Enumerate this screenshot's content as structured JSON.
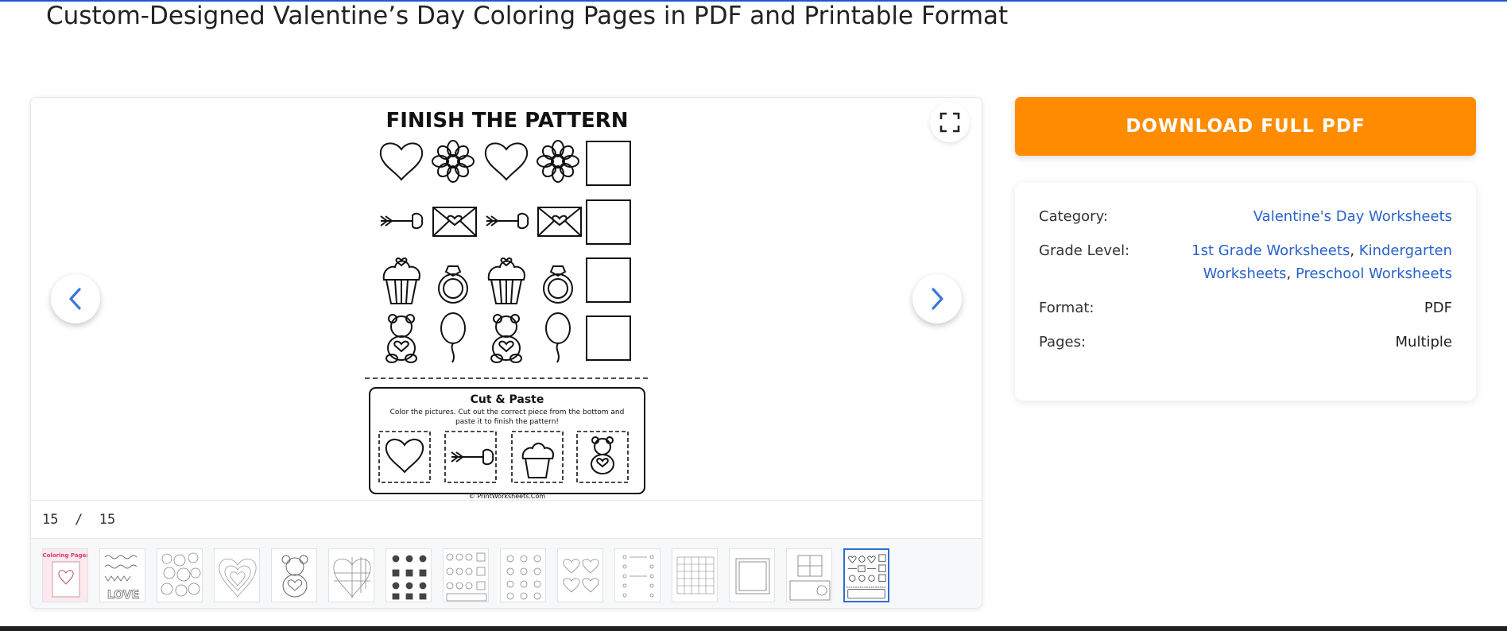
{
  "page": {
    "title": "Custom-Designed Valentine’s Day Coloring Pages in PDF and Printable Format"
  },
  "viewer": {
    "current_page": "15",
    "separator": "/",
    "total_pages": "15",
    "sheet": {
      "title": "FINISH THE PATTERN",
      "cut_title": "Cut & Paste",
      "instructions_line1": "Color the pictures. Cut out the correct piece from the bottom and",
      "instructions_line2": "paste it to finish the pattern!",
      "footer": "© PrintWorksheets.Com"
    },
    "thumbnails": [
      {
        "name": "thumb-1",
        "caption": "Coloring Pages"
      },
      {
        "name": "thumb-2",
        "caption": "LOVE"
      },
      {
        "name": "thumb-3",
        "caption": ""
      },
      {
        "name": "thumb-4",
        "caption": ""
      },
      {
        "name": "thumb-5",
        "caption": ""
      },
      {
        "name": "thumb-6",
        "caption": ""
      },
      {
        "name": "thumb-7",
        "caption": ""
      },
      {
        "name": "thumb-8",
        "caption": ""
      },
      {
        "name": "thumb-9",
        "caption": ""
      },
      {
        "name": "thumb-10",
        "caption": ""
      },
      {
        "name": "thumb-11",
        "caption": ""
      },
      {
        "name": "thumb-12",
        "caption": ""
      },
      {
        "name": "thumb-13",
        "caption": ""
      },
      {
        "name": "thumb-14",
        "caption": ""
      },
      {
        "name": "thumb-15",
        "caption": ""
      }
    ],
    "active_thumbnail": 15
  },
  "sidebar": {
    "download_label": "DOWNLOAD FULL PDF",
    "accent_color": "#ff8c00",
    "link_color": "#2a62c9",
    "meta": {
      "category_label": "Category:",
      "category_value": "Valentine's Day Worksheets",
      "grade_label": "Grade Level:",
      "grade_links": [
        "1st Grade Worksheets",
        "Kindergarten",
        "Worksheets",
        "Preschool Worksheets"
      ],
      "grade_separator": ",",
      "format_label": "Format:",
      "format_value": "PDF",
      "pages_label": "Pages:",
      "pages_value": "Multiple"
    }
  },
  "icons": {
    "fullscreen": "fullscreen-icon",
    "prev": "chevron-left-icon",
    "next": "chevron-right-icon"
  }
}
